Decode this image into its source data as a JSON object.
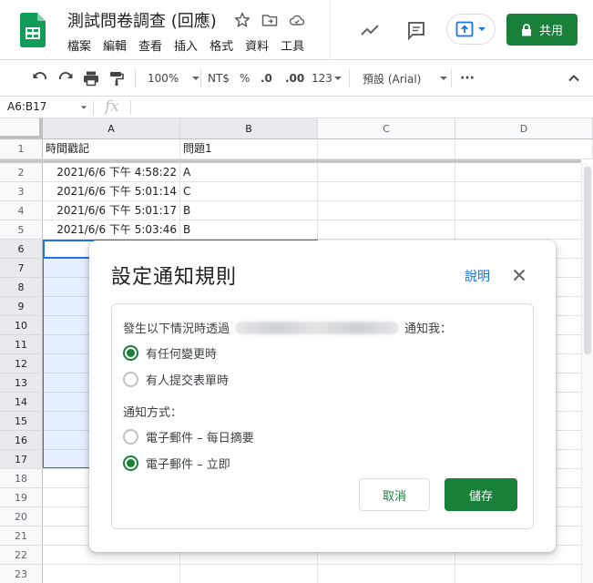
{
  "header": {
    "doc_title": "測試問卷調查 (回應)",
    "menu": [
      "檔案",
      "編輯",
      "查看",
      "插入",
      "格式",
      "資料",
      "工具"
    ],
    "share_label": "共用"
  },
  "toolbar": {
    "zoom": "100%",
    "currency": "NT$",
    "percent": "%",
    "decimal_decrease": ".0",
    "decimal_increase": ".00",
    "number_format": "123",
    "font": "預設 (Arial)",
    "more": "···"
  },
  "formula_bar": {
    "name_box": "A6:B17",
    "fx": "fx"
  },
  "sheet": {
    "columns": [
      "A",
      "B",
      "C",
      "D"
    ],
    "rows": [
      "1",
      "2",
      "3",
      "4",
      "5",
      "6",
      "7",
      "8",
      "9",
      "10",
      "11",
      "12",
      "13",
      "14",
      "15",
      "16",
      "17",
      "18",
      "19",
      "20",
      "21",
      "22",
      "23"
    ],
    "header_row": [
      "時間戳記",
      "問題1"
    ],
    "data": [
      [
        "2021/6/6 下午 4:58:22",
        "A"
      ],
      [
        "2021/6/6 下午 5:01:14",
        "C"
      ],
      [
        "2021/6/6 下午 5:01:17",
        "B"
      ],
      [
        "2021/6/6 下午 5:03:46",
        "B"
      ]
    ]
  },
  "dialog": {
    "title": "設定通知規則",
    "help": "說明",
    "notify_prefix": "發生以下情況時透過",
    "notify_suffix": "通知我：",
    "trigger_options": [
      {
        "label": "有任何變更時",
        "selected": true
      },
      {
        "label": "有人提交表單時",
        "selected": false
      }
    ],
    "method_label": "通知方式：",
    "method_options": [
      {
        "label": "電子郵件 – 每日摘要",
        "selected": false
      },
      {
        "label": "電子郵件 – 立即",
        "selected": true
      }
    ],
    "cancel_label": "取消",
    "save_label": "儲存"
  },
  "colors": {
    "accent_green": "#188038",
    "selection_blue": "#1a73e8",
    "sheets_logo": "#0f9d58"
  }
}
